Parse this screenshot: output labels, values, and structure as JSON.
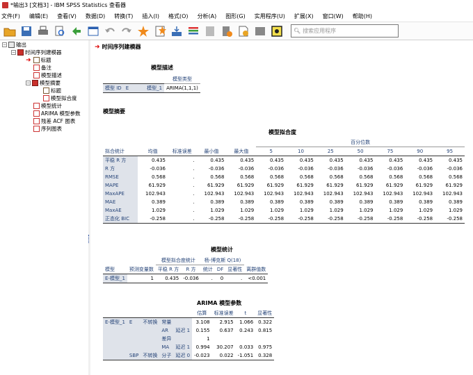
{
  "window": {
    "title": "*输出3 [文档3] - IBM SPSS Statistics 查看器"
  },
  "menu": [
    "文件(F)",
    "编辑(E)",
    "查看(V)",
    "数据(D)",
    "转换(T)",
    "插入(I)",
    "格式(O)",
    "分析(A)",
    "图形(G)",
    "实用程序(U)",
    "扩展(X)",
    "窗口(W)",
    "帮助(H)"
  ],
  "toolbar": {
    "search_placeholder": "搜索应用程序"
  },
  "tree": {
    "root": "输出",
    "proc": "时间序列建模器",
    "items": [
      "标题",
      "备注",
      "模型描述",
      "模型摘要",
      "标题",
      "模型拟合度",
      "模型统计",
      "ARIMA 模型参数",
      "残差 ACF 图表",
      "序列图表"
    ]
  },
  "output": {
    "proc_title": "时间序列建模器",
    "desc": {
      "title": "模型描述",
      "col_header": "模型类型",
      "row_label": "模型 ID",
      "row_var": "E",
      "model": "模型_1",
      "type": "ARIMA(1,1,1)"
    },
    "summary_heading": "模型摘要",
    "fit": {
      "title": "模型拟合度",
      "percentile_header": "百分位数",
      "headers": [
        "拟合统计",
        "均值",
        "标准误差",
        "最小值",
        "最大值",
        "5",
        "10",
        "25",
        "50",
        "75",
        "90",
        "95"
      ],
      "rows": [
        [
          "平稳 R 方",
          "0.435",
          ".",
          "0.435",
          "0.435",
          "0.435",
          "0.435",
          "0.435",
          "0.435",
          "0.435",
          "0.435",
          "0.435"
        ],
        [
          "R 方",
          "-0.036",
          ".",
          "-0.036",
          "-0.036",
          "-0.036",
          "-0.036",
          "-0.036",
          "-0.036",
          "-0.036",
          "-0.036",
          "-0.036"
        ],
        [
          "RMSE",
          "0.568",
          ".",
          "0.568",
          "0.568",
          "0.568",
          "0.568",
          "0.568",
          "0.568",
          "0.568",
          "0.568",
          "0.568"
        ],
        [
          "MAPE",
          "61.929",
          ".",
          "61.929",
          "61.929",
          "61.929",
          "61.929",
          "61.929",
          "61.929",
          "61.929",
          "61.929",
          "61.929"
        ],
        [
          "MaxAPE",
          "102.943",
          ".",
          "102.943",
          "102.943",
          "102.943",
          "102.943",
          "102.943",
          "102.943",
          "102.943",
          "102.943",
          "102.943"
        ],
        [
          "MAE",
          "0.389",
          ".",
          "0.389",
          "0.389",
          "0.389",
          "0.389",
          "0.389",
          "0.389",
          "0.389",
          "0.389",
          "0.389"
        ],
        [
          "MaxAE",
          "1.029",
          ".",
          "1.029",
          "1.029",
          "1.029",
          "1.029",
          "1.029",
          "1.029",
          "1.029",
          "1.029",
          "1.029"
        ],
        [
          "正态化 BIC",
          "-0.258",
          ".",
          "-0.258",
          "-0.258",
          "-0.258",
          "-0.258",
          "-0.258",
          "-0.258",
          "-0.258",
          "-0.258",
          "-0.258"
        ]
      ]
    },
    "stats": {
      "title": "模型统计",
      "group1": "模型拟合度统计",
      "group2": "杨-博克斯 Q(18)",
      "headers": [
        "模型",
        "预测变量数",
        "平稳 R 方",
        "R 方",
        "统计",
        "DF",
        "显著性",
        "离群值数"
      ],
      "row": [
        "E-模型_1",
        "1",
        "0.435",
        "-0.036",
        ".",
        "0",
        ".",
        "<0.001"
      ]
    },
    "arima": {
      "title": "ARIMA 模型参数",
      "headers": [
        "估算",
        "标准误差",
        "t",
        "显著性"
      ],
      "rows": [
        [
          "E-模型_1",
          "E",
          "不转换",
          "常量",
          "",
          "3.108",
          "2.915",
          "1.066",
          "0.322"
        ],
        [
          "",
          "",
          "",
          "AR",
          "延迟 1",
          "0.155",
          "0.637",
          "0.243",
          "0.815"
        ],
        [
          "",
          "",
          "",
          "差异",
          "",
          "1",
          "",
          "",
          ""
        ],
        [
          "",
          "",
          "",
          "MA",
          "延迟 1",
          "0.994",
          "30.207",
          "0.033",
          "0.975"
        ],
        [
          "",
          "SBP",
          "不转换",
          "分子",
          "延迟 0",
          "-0.023",
          "0.022",
          "-1.051",
          "0.328"
        ]
      ]
    }
  }
}
